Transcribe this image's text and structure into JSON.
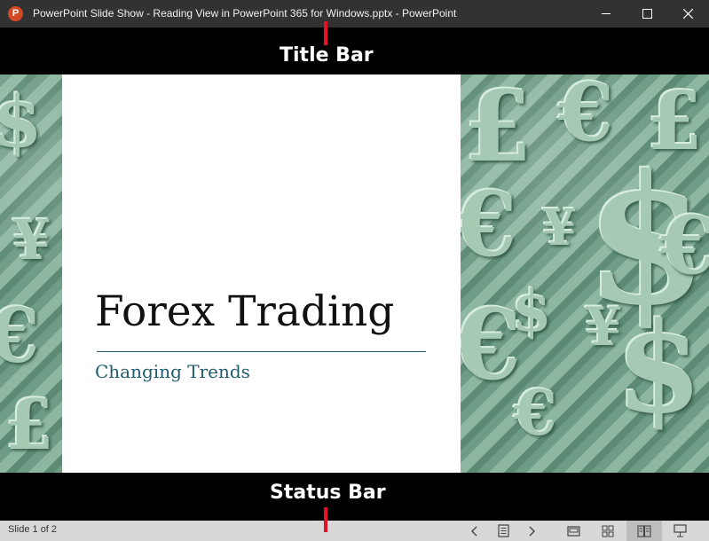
{
  "window": {
    "app_icon_letter": "P",
    "title": "PowerPoint Slide Show  -  Reading View in PowerPoint 365 for Windows.pptx - PowerPoint"
  },
  "annotations": {
    "title_bar_label": "Title Bar",
    "status_bar_label": "Status Bar",
    "line_color": "#e81123"
  },
  "slide": {
    "title": "Forex Trading",
    "subtitle": "Changing Trends",
    "subtitle_color": "#1f5c6e",
    "background_image": "currency-symbols-green"
  },
  "status_bar": {
    "slide_counter": "Slide 1 of 2",
    "buttons": [
      "previous-icon",
      "menu-icon",
      "next-icon",
      "normal-view-icon",
      "slide-sorter-icon",
      "reading-view-icon",
      "slide-show-icon"
    ],
    "active_view": "reading-view"
  }
}
